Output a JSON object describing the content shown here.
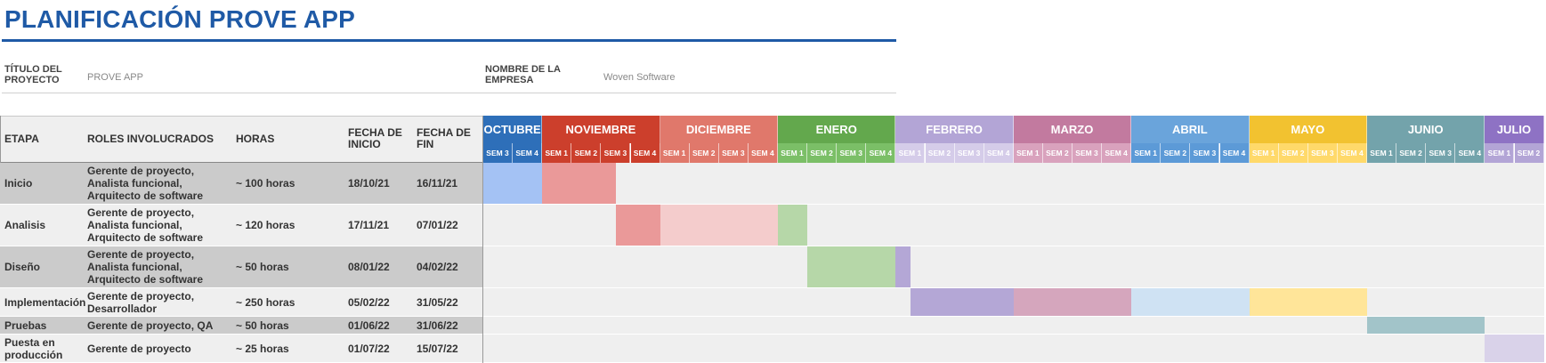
{
  "page_title": "PLANIFICACIÓN PROVE APP",
  "project": {
    "title_label_line1": "TÍTULO DEL",
    "title_label_line2": "PROYECTO",
    "title_value": "PROVE APP",
    "company_label_line1": "NOMBRE DE LA",
    "company_label_line2": "EMPRESA",
    "company_value": "Woven Software"
  },
  "table_headers": {
    "stage": "ETAPA",
    "roles": "ROLES INVOLUCRADOS",
    "hours": "HORAS",
    "start_line1": "FECHA DE",
    "start_line2": "INICIO",
    "end_line1": "FECHA DE",
    "end_line2": "FIN"
  },
  "months": [
    {
      "name": "OCTUBRE",
      "color": "#2e6fb9",
      "week_color": "#2e6fb9",
      "week_text": "#ffffff",
      "weeks": [
        "SEM 3",
        "SEM 4"
      ]
    },
    {
      "name": "NOVIEMBRE",
      "color": "#cc3f2c",
      "week_color": "#cc3f2c",
      "week_text": "#ffffff",
      "weeks": [
        "SEM 1",
        "SEM 2",
        "SEM 3",
        "SEM 4"
      ]
    },
    {
      "name": "DICIEMBRE",
      "color": "#e0786b",
      "week_color": "#e0786b",
      "week_text": "#ffffff",
      "weeks": [
        "SEM 1",
        "SEM 2",
        "SEM 3",
        "SEM 4"
      ]
    },
    {
      "name": "ENERO",
      "color": "#63a84d",
      "week_color": "#7bbf67",
      "week_text": "#ffffff",
      "weeks": [
        "SEM 1",
        "SEM 2",
        "SEM 3",
        "SEM 4"
      ]
    },
    {
      "name": "FEBRERO",
      "color": "#b3a5d6",
      "week_color": "#d5cce9",
      "week_text": "#ffffff",
      "weeks": [
        "SEM 1",
        "SEM 2",
        "SEM 3",
        "SEM 4"
      ]
    },
    {
      "name": "MARZO",
      "color": "#c27a9f",
      "week_color": "#d9a2bd",
      "week_text": "#ffffff",
      "weeks": [
        "SEM 1",
        "SEM 2",
        "SEM 3",
        "SEM 4"
      ]
    },
    {
      "name": "ABRIL",
      "color": "#6aa4db",
      "week_color": "#5c9ad7",
      "week_text": "#ffffff",
      "weeks": [
        "SEM 1",
        "SEM 2",
        "SEM 3",
        "SEM 4"
      ]
    },
    {
      "name": "MAYO",
      "color": "#f2c230",
      "week_color": "#ffd96a",
      "week_text": "#ffffff",
      "weeks": [
        "SEM 1",
        "SEM 2",
        "SEM 3",
        "SEM 4"
      ]
    },
    {
      "name": "JUNIO",
      "color": "#73a3ab",
      "week_color": "#73a3ab",
      "week_text": "#ffffff",
      "weeks": [
        "SEM 1",
        "SEM 2",
        "SEM 3",
        "SEM 4"
      ]
    },
    {
      "name": "JULIO",
      "color": "#8e72c4",
      "week_color": "#b3a5d6",
      "week_text": "#ffffff",
      "weeks": [
        "SEM 1",
        "SEM 2"
      ]
    }
  ],
  "stages": [
    {
      "stage": "Inicio",
      "roles": "Gerente de proyecto, Analista funcional, Arquitecto de software",
      "hours": "~ 100 horas",
      "start": "18/10/21",
      "end": "16/11/21",
      "row_bg": "#cbcbcb",
      "bars": [
        {
          "from_week": 0,
          "to_week": 2,
          "color": "#a4c2f4"
        },
        {
          "from_week": 2,
          "to_week": 4.5,
          "color": "#ea9999"
        }
      ]
    },
    {
      "stage": "Analisis",
      "roles": "Gerente de proyecto, Analista funcional, Arquitecto de software",
      "hours": "~ 120 horas",
      "start": "17/11/21",
      "end": "07/01/22",
      "row_bg": "#efefef",
      "bars": [
        {
          "from_week": 4.5,
          "to_week": 6,
          "color": "#ea9999"
        },
        {
          "from_week": 6,
          "to_week": 10,
          "color": "#f4cccc"
        },
        {
          "from_week": 10,
          "to_week": 11,
          "color": "#b6d7a8"
        }
      ]
    },
    {
      "stage": "Diseño",
      "roles": "Gerente de proyecto, Analista funcional, Arquitecto de software",
      "hours": "~ 50 horas",
      "start": "08/01/22",
      "end": "04/02/22",
      "row_bg": "#cbcbcb",
      "bars": [
        {
          "from_week": 11,
          "to_week": 14,
          "color": "#b6d7a8"
        },
        {
          "from_week": 14,
          "to_week": 14.5,
          "color": "#b4a7d6"
        }
      ]
    },
    {
      "stage": "Implementación",
      "roles": "Gerente de proyecto, Desarrollador",
      "hours": "~ 250 horas",
      "start": "05/02/22",
      "end": "31/05/22",
      "row_bg": "#efefef",
      "bars": [
        {
          "from_week": 14.5,
          "to_week": 18,
          "color": "#b4a7d6"
        },
        {
          "from_week": 18,
          "to_week": 22,
          "color": "#d5a6bd"
        },
        {
          "from_week": 22,
          "to_week": 26,
          "color": "#cfe2f3"
        },
        {
          "from_week": 26,
          "to_week": 30,
          "color": "#ffe599"
        }
      ]
    },
    {
      "stage": "Pruebas",
      "roles": "Gerente de proyecto, QA",
      "hours": "~ 50 horas",
      "start": "01/06/22",
      "end": "31/06/22",
      "row_bg": "#cbcbcb",
      "bars": [
        {
          "from_week": 30,
          "to_week": 34,
          "color": "#a2c4c9"
        }
      ]
    },
    {
      "stage": "Puesta en producción",
      "roles": "Gerente de proyecto",
      "hours": "~ 25 horas",
      "start": "01/07/22",
      "end": "15/07/22",
      "row_bg": "#efefef",
      "bars": [
        {
          "from_week": 34,
          "to_week": 36,
          "color": "#d9d2e9"
        }
      ]
    }
  ]
}
